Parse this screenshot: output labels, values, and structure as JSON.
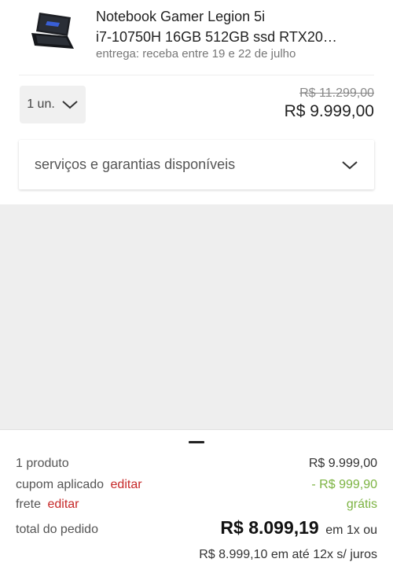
{
  "product": {
    "title_line1": "Notebook Gamer Legion 5i",
    "title_line2": "i7-10750H 16GB 512GB ssd RTX20…",
    "delivery": "entrega: receba entre 19 e 22 de julho",
    "image_icon": "laptop-icon"
  },
  "quantity": {
    "label": "1 un."
  },
  "pricing": {
    "old_price": "R$ 11.299,00",
    "price": "R$ 9.999,00"
  },
  "services": {
    "label": "serviços e garantias disponíveis"
  },
  "summary": {
    "products_label": "1 produto",
    "products_value": "R$ 9.999,00",
    "coupon_label": "cupom aplicado",
    "coupon_edit": "editar",
    "coupon_value": "- R$ 999,90",
    "shipping_label": "frete",
    "shipping_edit": "editar",
    "shipping_value": "grátis",
    "total_label": "total do pedido",
    "total_value": "R$ 8.099,19",
    "total_suffix": "em 1x ou",
    "installments": "R$ 8.999,10 em até 12x s/ juros"
  },
  "colors": {
    "edit": "#c62828",
    "discount": "#7cb342"
  }
}
